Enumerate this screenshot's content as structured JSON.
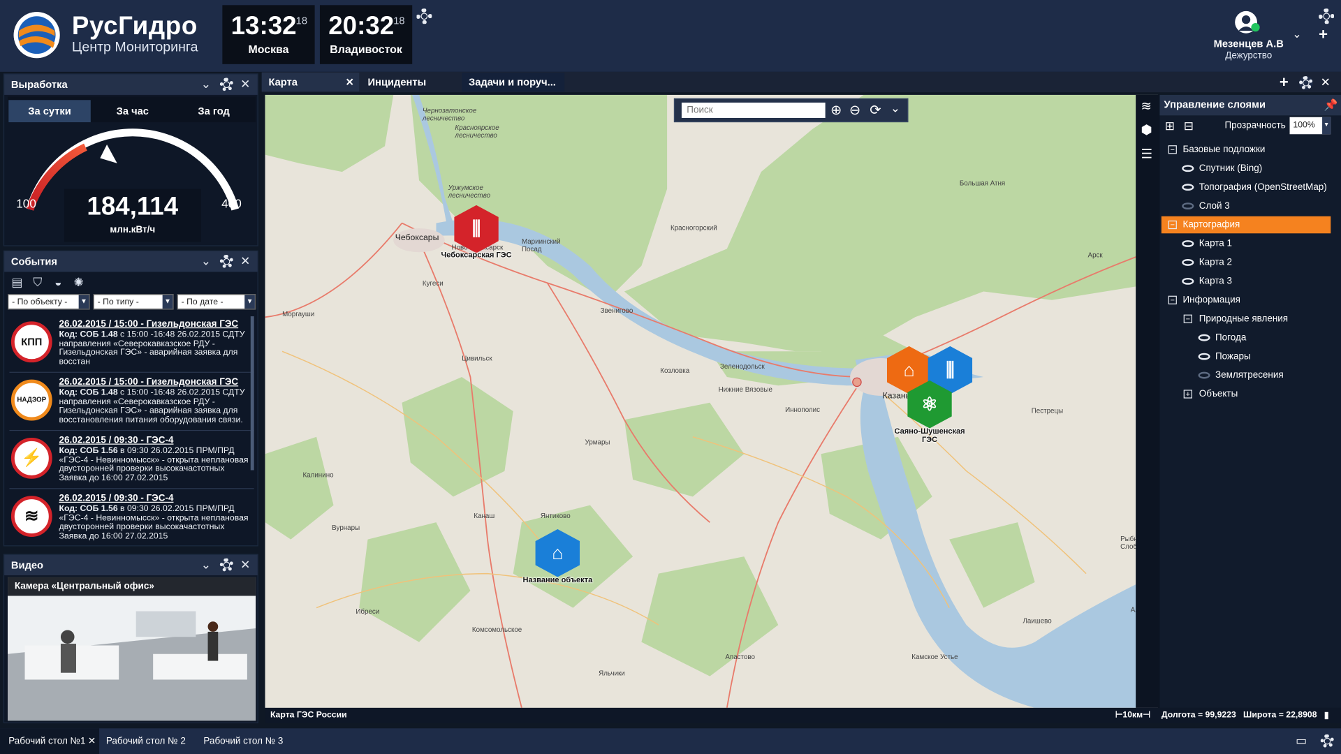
{
  "header": {
    "brand": "РусГидро",
    "subtitle": "Центр Мониторинга",
    "clocks": [
      {
        "time": "13:32",
        "sec": "18",
        "city": "Москва"
      },
      {
        "time": "20:32",
        "sec": "18",
        "city": "Владивосток"
      }
    ],
    "user": {
      "name": "Мезенцев А.В",
      "role": "Дежурство",
      "status_color": "#22c55e"
    }
  },
  "production": {
    "title": "Выработка",
    "tabs": [
      "За сутки",
      "За час",
      "За год"
    ],
    "active_tab": "За сутки",
    "gauge_min": "100",
    "gauge_max": "400",
    "value": "184,114",
    "unit": "млн.кВт/ч",
    "value_num": 184.114
  },
  "events": {
    "title": "События",
    "filters": [
      "- По объекту -",
      "- По типу -",
      "- По дате -"
    ],
    "items": [
      {
        "icon": "КПП",
        "head": "26.02.2015 / 15:00 - Гизельдонская ГЭС",
        "code": "Код: СОБ 1.48",
        "text": "с 15:00 -16:48 26.02.2015 СДТУ направления «Северокавказское РДУ - Гизельдонская ГЭС» - аварийная заявка для восстан"
      },
      {
        "icon": "НАДЗОР",
        "head": "26.02.2015 / 15:00 - Гизельдонская ГЭС",
        "code": "Код: СОБ 1.48",
        "text": "с 15:00 -16:48 26.02.2015 СДТУ направления «Северокавказское РДУ - Гизельдонская ГЭС» - аварийная заявка для восстановления питания оборудования связи."
      },
      {
        "icon": "⚡",
        "head": "26.02.2015 / 09:30 - ГЭС-4",
        "code": "Код: СОБ 1.56",
        "text": "в 09:30 26.02.2015 ПРМ/ПРД «ГЭС-4 - Невинномысск» - открыта неплановая двусторонней проверки высокачастотных Заявка до 16:00 27.02.2015"
      },
      {
        "icon": "≋",
        "head": "26.02.2015 / 09:30 - ГЭС-4",
        "code": "Код: СОБ 1.56",
        "text": "в 09:30 26.02.2015 ПРМ/ПРД «ГЭС-4 - Невинномысск» - открыта неплановая двусторонней проверки высокачастотных Заявка до 16:00 27.02.2015"
      }
    ]
  },
  "video": {
    "title": "Видео",
    "camera": "Камера «Центральный офис»"
  },
  "tabs": [
    "Карта",
    "Инциденты",
    "Задачи и поруч..."
  ],
  "map": {
    "search_placeholder": "Поиск",
    "caption": "Карта ГЭС России",
    "scale": "10км",
    "coords": "Долгота = 99,9223   Широта = 22,8908",
    "labels": {
      "cheb": "Чебоксары",
      "novo": "Новочебоксарск",
      "kazan": "Казань",
      "marinsky": "Мариинский Посад",
      "kugesi": "Кугеси",
      "morgaushi": "Моргауши",
      "tsivilsk": "Цивильск",
      "kozlovka": "Козловка",
      "zelenodolsk": "Зеленодольск",
      "vyazovye": "Нижние Вязовые",
      "innopolis": "Иннополис",
      "urmary": "Урмары",
      "kalinino": "Калинино",
      "vurnary": "Вурнары",
      "kanash": "Канаш",
      "yantikovo": "Янтиково",
      "ibresi": "Ибреси",
      "komsomolskoe": "Комсомольское",
      "apastovo": "Апастово",
      "yalchiki": "Яльчики",
      "kamskoe": "Камское Устье",
      "laishevo": "Лаишево",
      "alekseevskoe": "Алексеевское",
      "rybnaya": "Рыбная Слобода",
      "pestretsy": "Пестрецы",
      "arsk": "Арск",
      "atnya": "Большая Атня",
      "krasnogorsky": "Красногорский",
      "zvenigovo": "Звенигово",
      "urzhumskoe": "Уржумское лесничество",
      "chernozat": "Чернозатонское лесничество",
      "krasnoyar": "Красноярское лесничество"
    },
    "objects": [
      {
        "name": "Чебоксарская ГЭС",
        "color": "#d4232a",
        "icon": "hydro"
      },
      {
        "name": "Название объекта",
        "color": "#1a7fd8",
        "icon": "factory"
      },
      {
        "name": "",
        "color": "#ee6a12",
        "icon": "factory"
      },
      {
        "name": "",
        "color": "#1a7fd8",
        "icon": "hydro"
      },
      {
        "name": "Саяно-Шушенская ГЭС",
        "color": "#1f9a32",
        "icon": "atom"
      }
    ]
  },
  "layers": {
    "title": "Управление слоями",
    "opacity_label": "Прозрачность",
    "opacity_value": "100%",
    "rows": [
      {
        "label": "Базовые подложки",
        "kind": "group-open"
      },
      {
        "label": "Спутник (Bing)",
        "kind": "eye"
      },
      {
        "label": "Топография (OpenStreetMap)",
        "kind": "eye"
      },
      {
        "label": "Слой 3",
        "kind": "eye-dim"
      },
      {
        "label": "Картография",
        "kind": "group-active"
      },
      {
        "label": "Карта 1",
        "kind": "eye"
      },
      {
        "label": "Карта 2",
        "kind": "eye"
      },
      {
        "label": "Карта 3",
        "kind": "eye"
      },
      {
        "label": "Информация",
        "kind": "group-open"
      },
      {
        "label": "Природные явления",
        "kind": "subgroup"
      },
      {
        "label": "Погода",
        "kind": "eye2"
      },
      {
        "label": "Пожары",
        "kind": "eye2"
      },
      {
        "label": "Землятресения",
        "kind": "eye2-dim"
      },
      {
        "label": "Объекты",
        "kind": "subgroup-closed"
      }
    ],
    "accent": "#f5821f"
  },
  "desktops": [
    "Рабочий стол №1",
    "Рабочий стол № 2",
    "Рабочий стол № 3"
  ]
}
